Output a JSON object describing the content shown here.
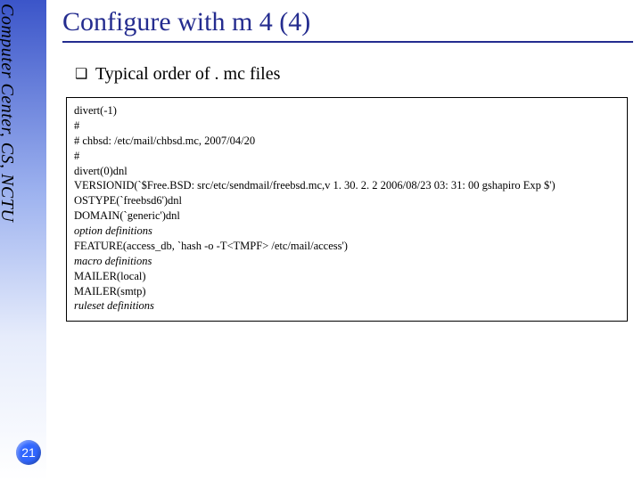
{
  "sidebar": {
    "label": "Computer Center, CS, NCTU"
  },
  "page_number": "21",
  "title": "Configure with m 4 (4)",
  "bullet": {
    "mark": "❑",
    "text": "Typical order of . mc files"
  },
  "code": {
    "lines": [
      {
        "text": "divert(-1)"
      },
      {
        "text": "#"
      },
      {
        "text": "# chbsd: /etc/mail/chbsd.mc, 2007/04/20"
      },
      {
        "text": "#"
      },
      {
        "text": "divert(0)dnl"
      },
      {
        "text": "VERSIONID(`$Free.BSD: src/etc/sendmail/freebsd.mc,v 1. 30. 2. 2 2006/08/23 03: 31: 00 gshapiro Exp $')"
      },
      {
        "text": "OSTYPE(`freebsd6')dnl"
      },
      {
        "text": "DOMAIN(`generic')dnl"
      },
      {
        "text": "option definitions",
        "italic": true
      },
      {
        "text": "FEATURE(access_db, `hash -o -T<TMPF> /etc/mail/access')"
      },
      {
        "text": "macro definitions",
        "italic": true
      },
      {
        "text": "MAILER(local)"
      },
      {
        "text": "MAILER(smtp)"
      },
      {
        "text": "ruleset definitions",
        "italic": true
      }
    ]
  }
}
